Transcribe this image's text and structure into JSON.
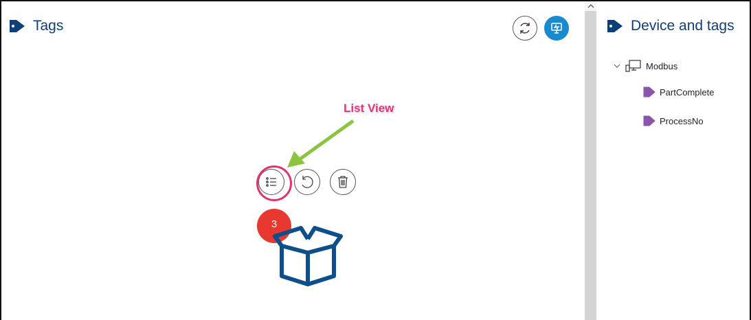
{
  "tags_panel": {
    "title": "Tags",
    "actions": {
      "refresh_icon": "refresh-icon",
      "monitor_icon": "monitor-icon"
    },
    "row_actions": {
      "list_view_icon": "list-icon",
      "undo_icon": "undo-icon",
      "delete_icon": "trash-icon"
    },
    "empty_state_icon": "open-box-icon"
  },
  "annotation": {
    "label": "List View",
    "step_number": "3",
    "label_color": "#e8337a",
    "arrow_color": "#8cc43f",
    "badge_color": "#e8382f"
  },
  "device_panel": {
    "title": "Device and tags",
    "tree": {
      "device": {
        "label": "Modbus",
        "expanded": true
      },
      "tags": [
        {
          "label": "PartComplete"
        },
        {
          "label": "ProcessNo"
        }
      ]
    }
  },
  "colors": {
    "title": "#0e3f78",
    "accent": "#1a8ad0",
    "tag_icon": "#8a56ac",
    "box_icon": "#0d4f8b"
  }
}
